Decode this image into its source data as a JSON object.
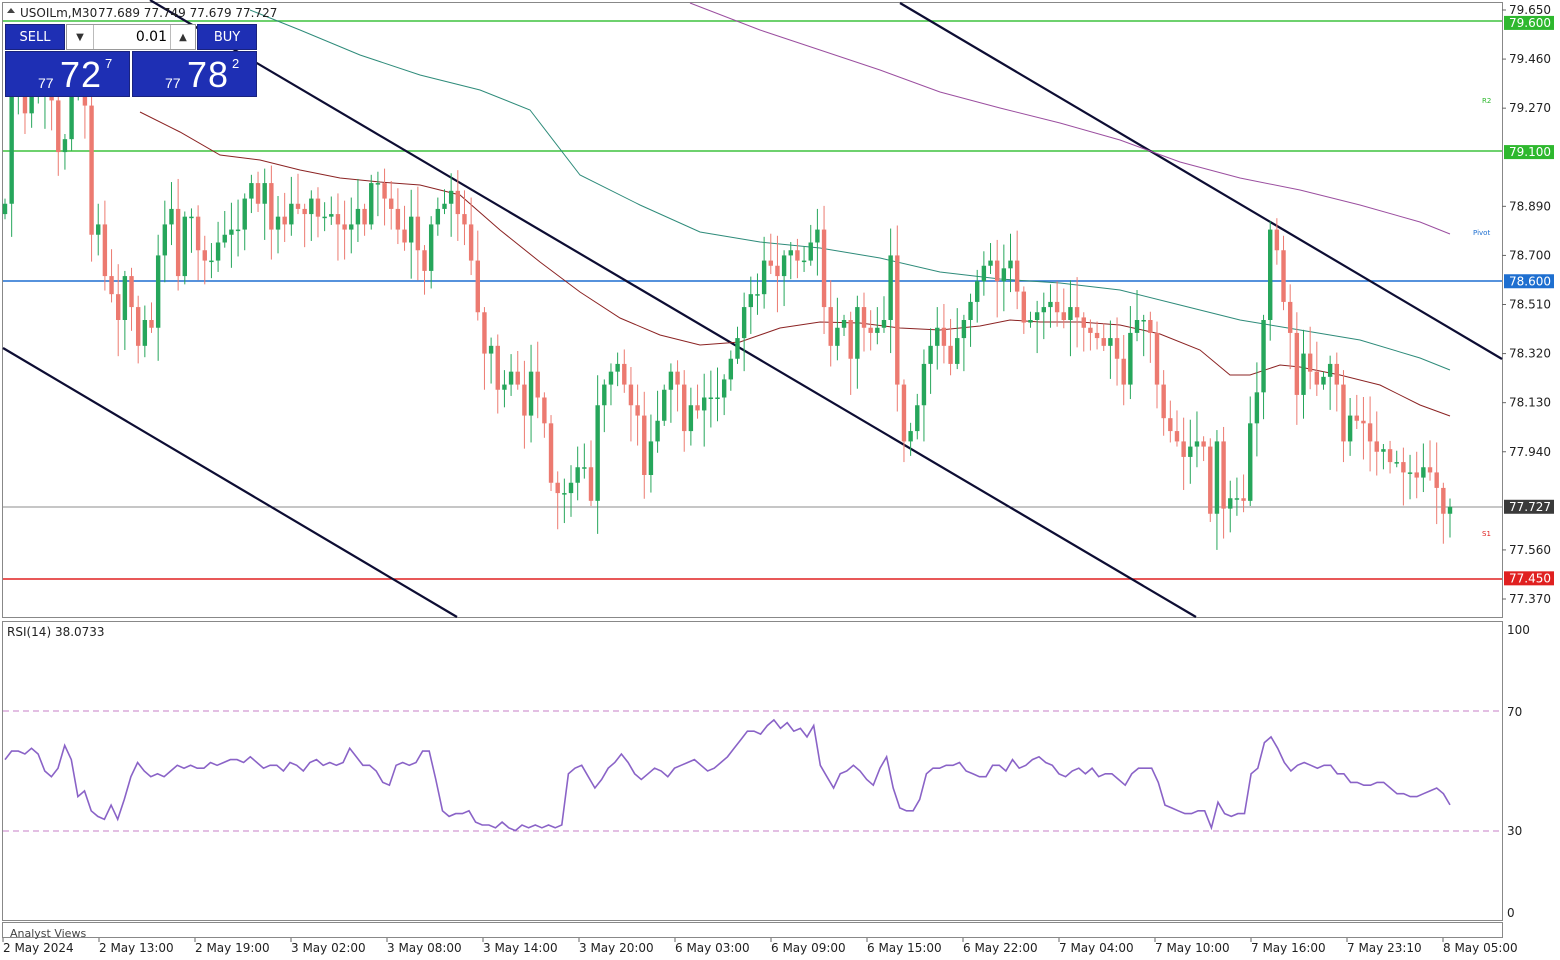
{
  "chart_header": {
    "symbol_tf": "USOILm,M30",
    "ohlc": "77.689 77.749 77.679 77.727"
  },
  "trade_panel": {
    "sell_label": "SELL",
    "buy_label": "BUY",
    "lot": "0.01",
    "sell_price": {
      "prefix": "77",
      "big": "72",
      "sup": "7"
    },
    "buy_price": {
      "prefix": "77",
      "big": "78",
      "sup": "2"
    }
  },
  "price_axis": [
    "79.650",
    "79.460",
    "79.270",
    "78.890",
    "78.700",
    "78.510",
    "78.320",
    "78.130",
    "77.940",
    "77.560",
    "77.370"
  ],
  "level_tags": [
    {
      "value": "79.600",
      "color": "#2eb82e"
    },
    {
      "value": "79.100",
      "color": "#2eb82e"
    },
    {
      "value": "78.600",
      "color": "#1e6fd0"
    },
    {
      "value": "77.727",
      "color": "#3a3a3a"
    },
    {
      "value": "77.450",
      "color": "#e02020"
    }
  ],
  "pivot_labels": [
    "R2",
    "Pivot",
    "S1"
  ],
  "rsi": {
    "label": "RSI(14) 38.0733",
    "axis": [
      "100",
      "70",
      "30",
      "0"
    ],
    "current": 38.0733
  },
  "bottom_label": "Analyst Views",
  "time_axis": [
    "2 May 2024",
    "2 May 13:00",
    "2 May 19:00",
    "3 May 02:00",
    "3 May 08:00",
    "3 May 14:00",
    "3 May 20:00",
    "6 May 03:00",
    "6 May 09:00",
    "6 May 15:00",
    "6 May 22:00",
    "7 May 04:00",
    "7 May 10:00",
    "7 May 16:00",
    "7 May 23:10",
    "8 May 05:00"
  ],
  "colors": {
    "bull": "#26a65b",
    "bear": "#ec7a70",
    "ma_fast": "#8b2323",
    "ma_mid": "#2e8b7a",
    "ma_slow": "#9b4fa0",
    "rsi": "#8a63c7",
    "channel": "#0d0d33"
  },
  "chart_data": {
    "type": "candlestick",
    "symbol": "USOILm",
    "timeframe": "M30",
    "y_range": [
      77.3,
      79.7
    ],
    "close": [
      78.9,
      79.35,
      79.4,
      79.25,
      79.32,
      79.33,
      79.36,
      79.3,
      79.1,
      79.15,
      79.32,
      79.38,
      79.28,
      78.78,
      78.82,
      78.62,
      78.55,
      78.45,
      78.62,
      78.5,
      78.35,
      78.45,
      78.42,
      78.7,
      78.82,
      78.88,
      78.62,
      78.85,
      78.85,
      78.72,
      78.68,
      78.68,
      78.75,
      78.78,
      78.8,
      78.8,
      78.92,
      78.98,
      78.9,
      78.98,
      78.8,
      78.85,
      78.82,
      78.9,
      78.88,
      78.86,
      78.92,
      78.85,
      78.85,
      78.86,
      78.82,
      78.8,
      78.82,
      78.88,
      78.82,
      78.98,
      78.98,
      78.92,
      78.88,
      78.8,
      78.75,
      78.85,
      78.72,
      78.64,
      78.82,
      78.88,
      78.9,
      78.95,
      78.86,
      78.82,
      78.68,
      78.48,
      78.32,
      78.35,
      78.18,
      78.2,
      78.25,
      78.2,
      78.08,
      78.25,
      78.15,
      78.05,
      77.82,
      77.78,
      77.78,
      77.82,
      77.88,
      77.88,
      77.75,
      78.12,
      78.2,
      78.25,
      78.28,
      78.2,
      78.12,
      78.08,
      77.85,
      77.98,
      78.06,
      78.18,
      78.25,
      78.2,
      78.02,
      78.12,
      78.1,
      78.15,
      78.15,
      78.15,
      78.22,
      78.3,
      78.38,
      78.5,
      78.55,
      78.55,
      78.68,
      78.66,
      78.62,
      78.7,
      78.72,
      78.68,
      78.68,
      78.75,
      78.8,
      78.5,
      78.35,
      78.42,
      78.45,
      78.3,
      78.5,
      78.42,
      78.4,
      78.42,
      78.45,
      78.7,
      78.2,
      77.98,
      78.02,
      78.12,
      78.28,
      78.35,
      78.42,
      78.35,
      78.28,
      78.38,
      78.45,
      78.52,
      78.6,
      78.66,
      78.68,
      78.6,
      78.65,
      78.68,
      78.56,
      78.44,
      78.45,
      78.48,
      78.5,
      78.52,
      78.48,
      78.45,
      78.5,
      78.46,
      78.42,
      78.4,
      78.38,
      78.35,
      78.38,
      78.3,
      78.2,
      78.4,
      78.45,
      78.45,
      78.4,
      78.2,
      78.07,
      78.02,
      77.98,
      77.92,
      77.96,
      77.98,
      77.96,
      77.7,
      77.98,
      77.72,
      77.76,
      77.76,
      77.75,
      78.05,
      78.17,
      78.45,
      78.8,
      78.72,
      78.52,
      78.4,
      78.16,
      78.32,
      78.25,
      78.2,
      78.23,
      78.28,
      78.2,
      77.98,
      78.08,
      78.06,
      78.05,
      77.98,
      77.94,
      77.95,
      77.9,
      77.9,
      77.86,
      77.86,
      77.84,
      77.88,
      77.86,
      77.8,
      77.7,
      77.727
    ]
  },
  "rsi_series": [
    54,
    57,
    57,
    56,
    58,
    56,
    50,
    48,
    51,
    59,
    54,
    41,
    43,
    36,
    34,
    33,
    38,
    33,
    40,
    48,
    53,
    50,
    48,
    49,
    48,
    50,
    52,
    51,
    52,
    51,
    51,
    53,
    52,
    53,
    54,
    54,
    53,
    55,
    53,
    51,
    52,
    52,
    50,
    53,
    52,
    50,
    53,
    54,
    52,
    53,
    52,
    53,
    58,
    55,
    52,
    52,
    50,
    46,
    45,
    52,
    53,
    52,
    53,
    57,
    57,
    47,
    36,
    34,
    35,
    35,
    36,
    32,
    31,
    31,
    30,
    32,
    30,
    29,
    31,
    30,
    31,
    30,
    31,
    30,
    31,
    49,
    51,
    52,
    48,
    44,
    47,
    51,
    53,
    56,
    53,
    49,
    47,
    49,
    51,
    50,
    48,
    51,
    52,
    53,
    54,
    52,
    50,
    51,
    53,
    55,
    58,
    61,
    64,
    64,
    63,
    66,
    68,
    65,
    67,
    64,
    65,
    62,
    66,
    52,
    48,
    44,
    49,
    50,
    52,
    50,
    47,
    45,
    51,
    55,
    44,
    37,
    36,
    36,
    40,
    49,
    51,
    51,
    52,
    52,
    53,
    50,
    49,
    48,
    48,
    52,
    52,
    50,
    54,
    51,
    52,
    54,
    55,
    53,
    52,
    49,
    48,
    50,
    51,
    49,
    51,
    48,
    49,
    49,
    47,
    45,
    49,
    51,
    51,
    51,
    46,
    38,
    37,
    36,
    35,
    35,
    36,
    36,
    30,
    39,
    35,
    34,
    35,
    35,
    49,
    51,
    60,
    62,
    58,
    53,
    50,
    52,
    53,
    52,
    51,
    52,
    52,
    49,
    49,
    46,
    46,
    45,
    45,
    46,
    46,
    44,
    42,
    42,
    41,
    41,
    42,
    43,
    44,
    42,
    38.0733
  ]
}
